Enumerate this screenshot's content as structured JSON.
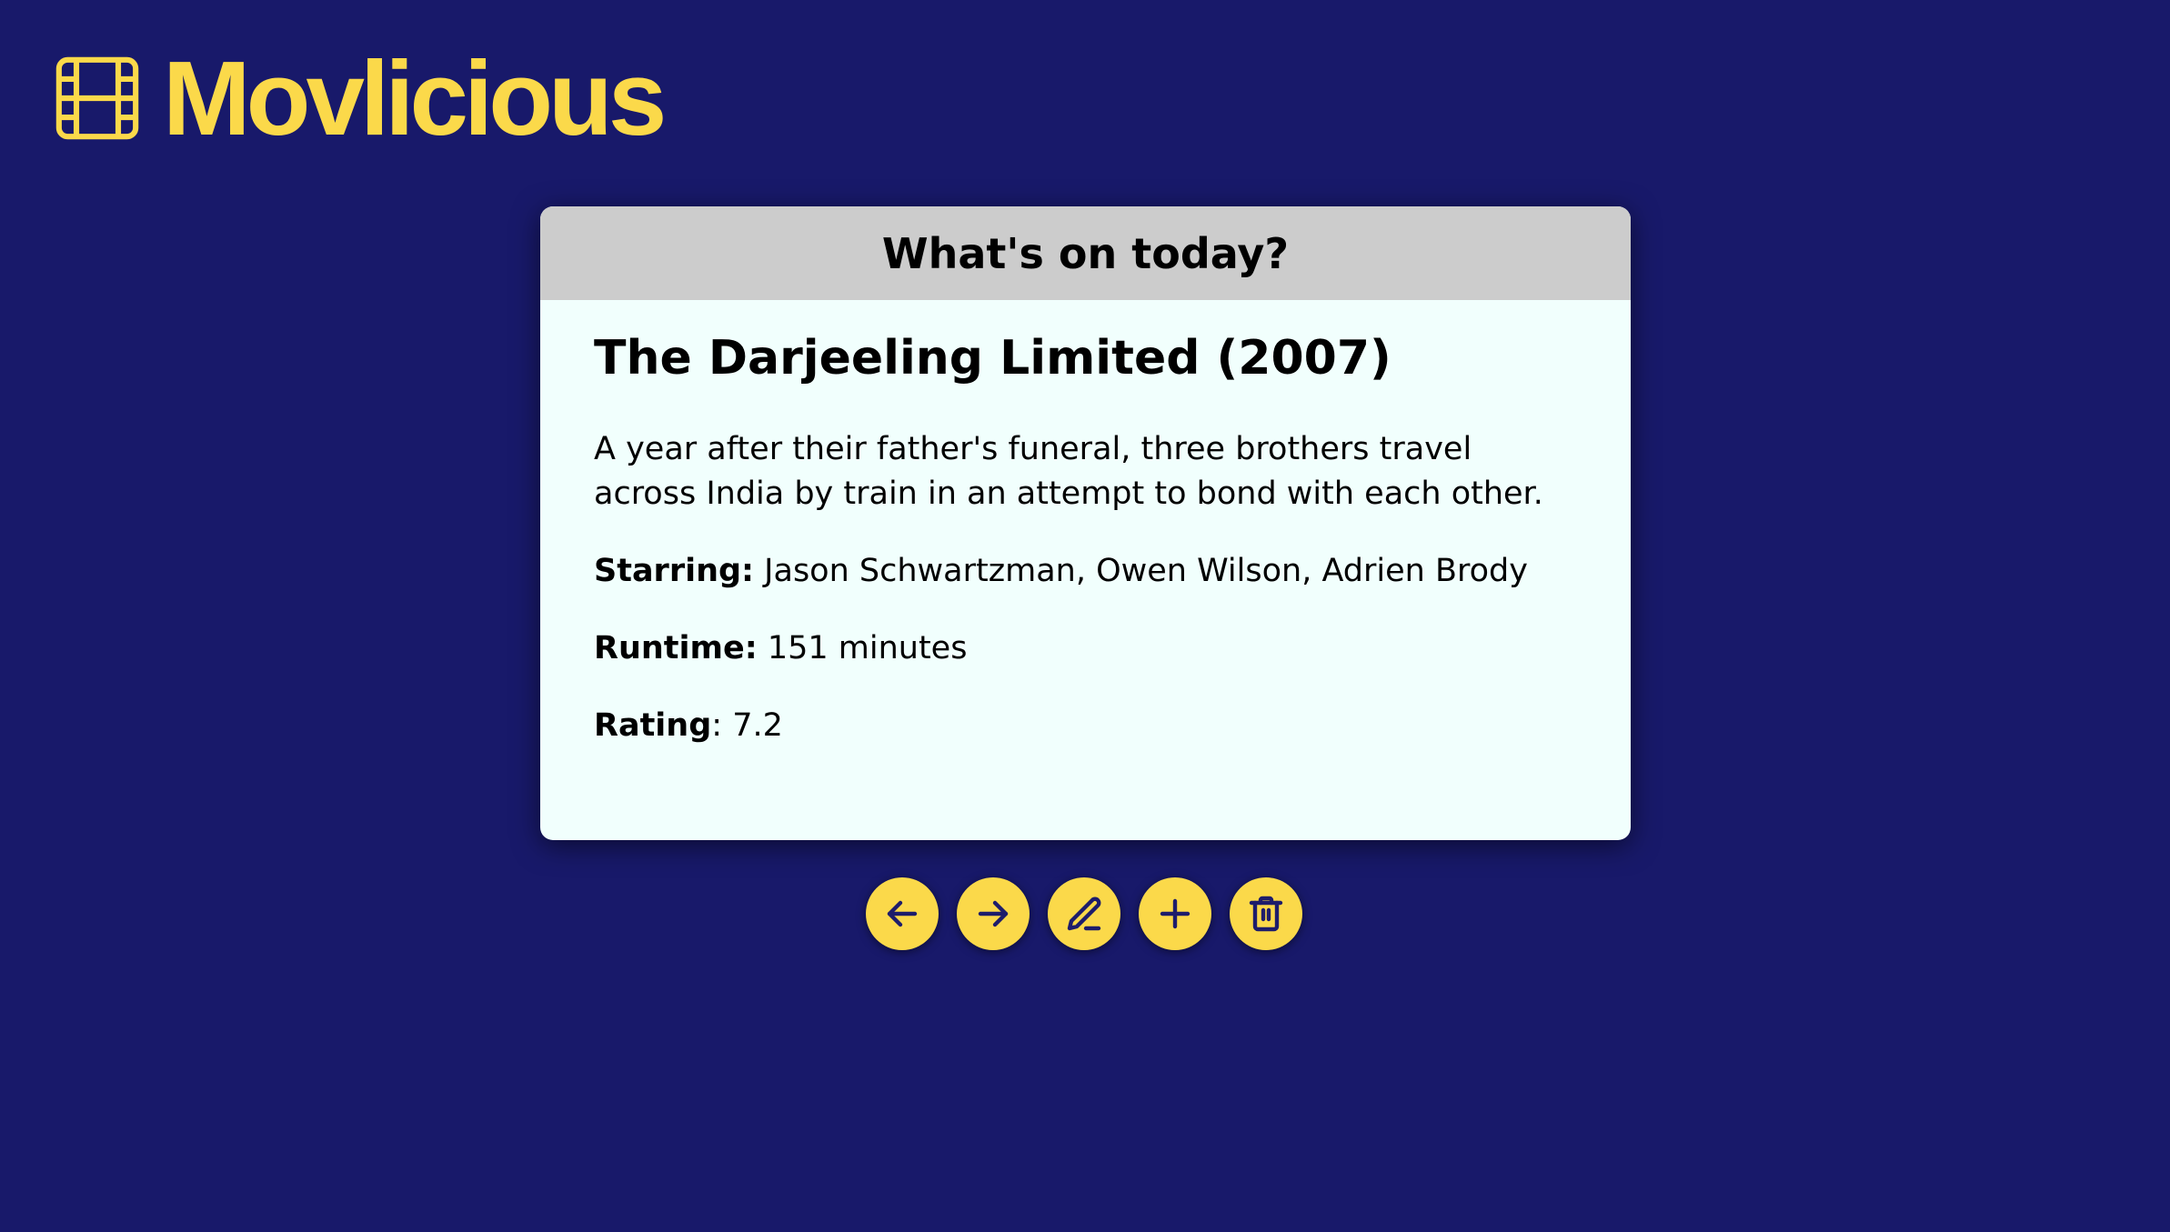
{
  "app": {
    "name": "Movlicious"
  },
  "card": {
    "header": "What's on today?",
    "movie": {
      "title": "The Darjeeling Limited (2007)",
      "description": "A year after their father's funeral, three brothers travel across India by train in an attempt to bond with each other.",
      "starring_label": "Starring:",
      "starring": " Jason Schwartzman, Owen Wilson, Adrien Brody",
      "runtime_label": "Runtime:",
      "runtime": " 151 minutes",
      "rating_label": "Rating",
      "rating": ": 7.2"
    }
  },
  "actions": [
    "arrow-left-icon",
    "arrow-right-icon",
    "pencil-icon",
    "plus-icon",
    "trash-icon"
  ],
  "colors": {
    "background": "#18196a",
    "accent": "#fbd94a",
    "card": "#f1fffd",
    "header": "#cccccc"
  }
}
